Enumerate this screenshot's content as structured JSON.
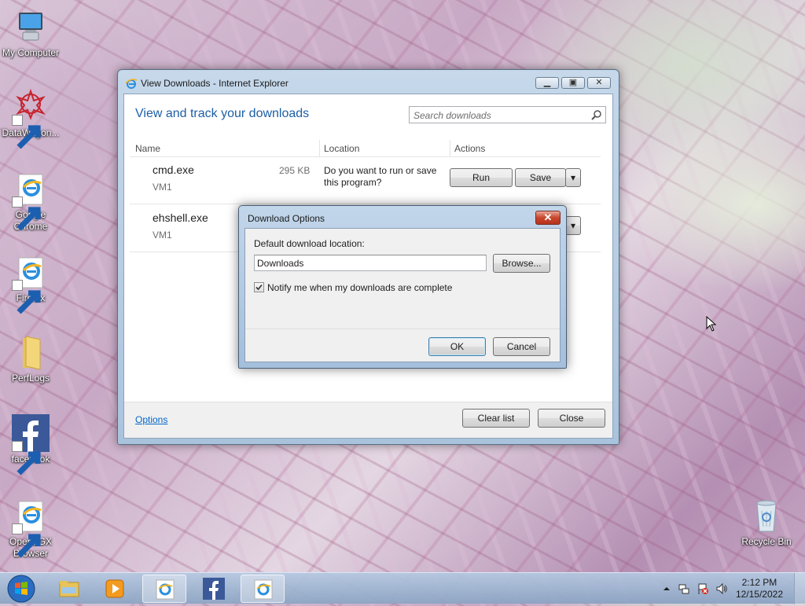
{
  "desktop": {
    "icons": [
      {
        "label": "My Computer",
        "icon": "computer-icon"
      },
      {
        "label": "DataWagon...",
        "icon": "datawagon-icon"
      },
      {
        "label": "Google Chrome",
        "icon": "ie-icon"
      },
      {
        "label": "Firefox",
        "icon": "ie-icon"
      },
      {
        "label": "PerfLogs",
        "icon": "folder-icon"
      },
      {
        "label": "facebook",
        "icon": "facebook-icon"
      },
      {
        "label": "Opera GX Browser",
        "icon": "ie-icon"
      },
      {
        "label": "Recycle Bin",
        "icon": "recycle-bin-icon"
      }
    ]
  },
  "window": {
    "title": "View Downloads - Internet Explorer",
    "heading": "View and track your downloads",
    "search_placeholder": "Search downloads",
    "columns": {
      "name": "Name",
      "location": "Location",
      "actions": "Actions"
    },
    "downloads": [
      {
        "file": "cmd.exe",
        "source": "VM1",
        "size": "295 KB",
        "prompt": "Do you want to run or save this program?",
        "run": "Run",
        "save": "Save"
      },
      {
        "file": "ehshell.exe",
        "source": "VM1"
      }
    ],
    "options_link": "Options",
    "clear_list": "Clear list",
    "close": "Close"
  },
  "dialog": {
    "title": "Download Options",
    "location_label": "Default download location:",
    "location_value": "Downloads",
    "browse": "Browse...",
    "notify_label": "Notify me when my downloads are complete",
    "notify_checked": true,
    "ok": "OK",
    "cancel": "Cancel"
  },
  "taskbar": {
    "time": "2:12 PM",
    "date": "12/15/2022",
    "items": [
      "windows-explorer-icon",
      "media-player-icon",
      "ie-icon",
      "facebook-icon",
      "ie-icon"
    ]
  }
}
